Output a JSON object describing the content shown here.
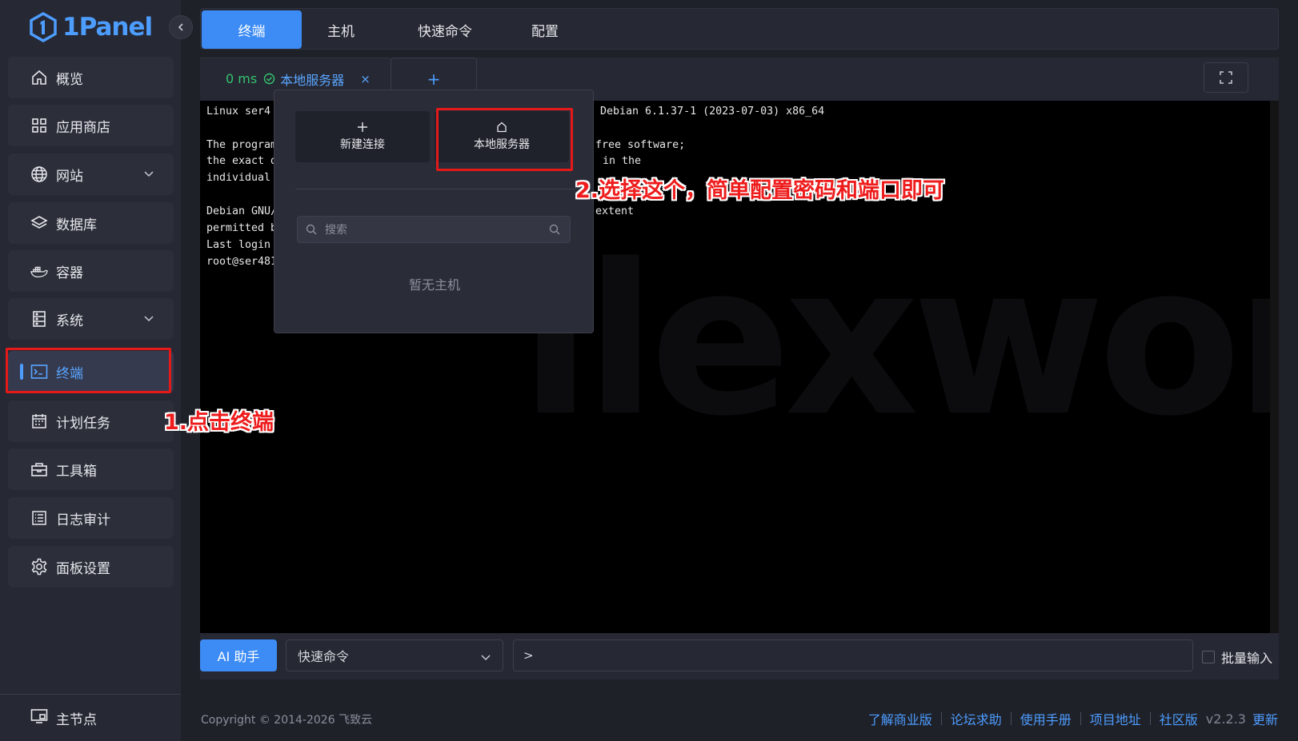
{
  "app": {
    "logo_text": "1Panel"
  },
  "sidebar": {
    "items": [
      {
        "label": "概览",
        "icon": "home-icon"
      },
      {
        "label": "应用商店",
        "icon": "apps-grid-icon"
      },
      {
        "label": "网站",
        "icon": "globe-icon",
        "expandable": true
      },
      {
        "label": "数据库",
        "icon": "layers-icon"
      },
      {
        "label": "容器",
        "icon": "docker-icon"
      },
      {
        "label": "系统",
        "icon": "server-icon",
        "expandable": true
      },
      {
        "label": "终端",
        "icon": "terminal-icon",
        "active": true
      },
      {
        "label": "计划任务",
        "icon": "calendar-icon"
      },
      {
        "label": "工具箱",
        "icon": "toolbox-icon"
      },
      {
        "label": "日志审计",
        "icon": "log-icon"
      },
      {
        "label": "面板设置",
        "icon": "gear-icon"
      }
    ],
    "bottom_label": "主节点"
  },
  "top_tabs": [
    {
      "label": "终端",
      "active": true
    },
    {
      "label": "主机"
    },
    {
      "label": "快速命令"
    },
    {
      "label": "配置"
    }
  ],
  "terminal_tab": {
    "latency": "0 ms",
    "server_name": "本地服务器",
    "close": "×",
    "add": "+"
  },
  "terminal_lines": [
    "Linux ser4",
    "",
    "The program",
    "the exact d",
    "individual",
    "",
    "Debian GNU/",
    "permitted b",
    "Last login",
    "root@ser481"
  ],
  "terminal_lines_right": [
    {
      "line": 0,
      "text": "Debian 6.1.37-1 (2023-07-03) x86_64"
    },
    {
      "line": 2,
      "text": "free software;"
    },
    {
      "line": 3,
      "text": "in the"
    },
    {
      "line": 7,
      "text": "extent"
    }
  ],
  "watermark_text": "ilexwork",
  "popover": {
    "new_connection": "新建连接",
    "local_server": "本地服务器",
    "search_placeholder": "搜索",
    "empty_text": "暂无主机"
  },
  "bottom_bar": {
    "ai_button": "AI 助手",
    "quick_command_placeholder": "快速命令",
    "command_prompt": ">",
    "batch_input_label": "批量输入"
  },
  "annotations": {
    "step1": "1.点击终端",
    "step2": "2.选择这个，简单配置密码和端口即可"
  },
  "footer": {
    "copyright": "Copyright © 2014-2026 飞致云",
    "links": [
      "了解商业版",
      "论坛求助",
      "使用手册",
      "项目地址",
      "社区版"
    ],
    "version": "v2.2.3",
    "update": "更新"
  },
  "colors": {
    "accent": "#3d8cf5",
    "success": "#34c36f",
    "annotation": "#e51919"
  }
}
